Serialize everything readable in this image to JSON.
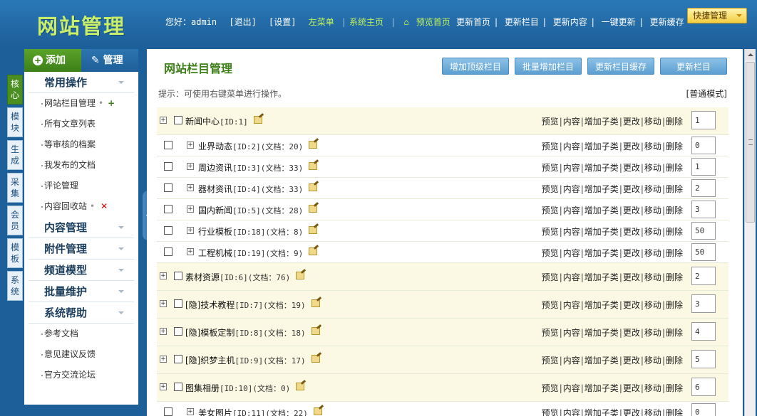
{
  "header": {
    "logo": "网站管理",
    "greeting": "您好：admin",
    "logout": "[退出]",
    "settings": "[设置]",
    "left_menu": "左菜单",
    "system_home": "系统主页",
    "preview_home": "预览首页",
    "links": [
      "更新首页",
      "更新栏目",
      "更新内容",
      "一键更新",
      "更新缓存"
    ],
    "quick_menu": "快捷管理"
  },
  "sidebar": {
    "add_label": "添加",
    "manage_label": "管理",
    "vertical_tabs": [
      "核心",
      "模块",
      "生成",
      "采集",
      "会员",
      "模板",
      "系统"
    ],
    "sections": [
      {
        "title": "常用操作",
        "items": [
          "网站栏目管理",
          "所有文章列表",
          "等审核的档案",
          "我发布的文档",
          "评论管理",
          "内容回收站"
        ]
      },
      {
        "title": "内容管理",
        "items": []
      },
      {
        "title": "附件管理",
        "items": []
      },
      {
        "title": "频道模型",
        "items": []
      },
      {
        "title": "批量维护",
        "items": []
      },
      {
        "title": "系统帮助",
        "items": [
          "参考文档",
          "意见建议反馈",
          "官方交流论坛"
        ]
      }
    ]
  },
  "main": {
    "title": "网站栏目管理",
    "buttons": [
      "增加顶级栏目",
      "批量增加栏目",
      "更新栏目缓存",
      "更新栏目"
    ],
    "hint": "提示：可使用右键菜单进行操作。",
    "mode": "[普通模式]",
    "actions": [
      "预览",
      "内容",
      "增加子类",
      "更改",
      "移动",
      "删除"
    ],
    "rows": [
      {
        "level": "top",
        "name": "新闻中心",
        "meta": "[ID:1]",
        "order": "1"
      },
      {
        "level": "sub",
        "name": "业界动态",
        "meta": "[ID:2](文档：20)",
        "order": "0"
      },
      {
        "level": "sub",
        "name": "周边资讯",
        "meta": "[ID:3](文档：33)",
        "order": "1"
      },
      {
        "level": "sub",
        "name": "器材资讯",
        "meta": "[ID:4](文档：33)",
        "order": "2"
      },
      {
        "level": "sub",
        "name": "国内新闻",
        "meta": "[ID:5](文档：28)",
        "order": "3"
      },
      {
        "level": "sub",
        "name": "行业模板",
        "meta": "[ID:18](文档：8)",
        "order": "50"
      },
      {
        "level": "sub",
        "name": "工程机械",
        "meta": "[ID:19](文档：9)",
        "order": "50"
      },
      {
        "level": "top",
        "name": "素材资源",
        "meta": "[ID:6](文档：76)",
        "order": "2"
      },
      {
        "level": "top",
        "name": "[隐]技术教程",
        "meta": "[ID:7](文档：19)",
        "order": "3"
      },
      {
        "level": "top",
        "name": "[隐]模板定制",
        "meta": "[ID:8](文档：18)",
        "order": "4"
      },
      {
        "level": "top",
        "name": "[隐]织梦主机",
        "meta": "[ID:9](文档：17)",
        "order": "5"
      },
      {
        "level": "top",
        "name": "图集相册",
        "meta": "[ID:10](文档：0)",
        "order": "6"
      },
      {
        "level": "sub",
        "name": "美女图片",
        "meta": "[ID:11](文档：22)",
        "order": "0"
      }
    ]
  }
}
